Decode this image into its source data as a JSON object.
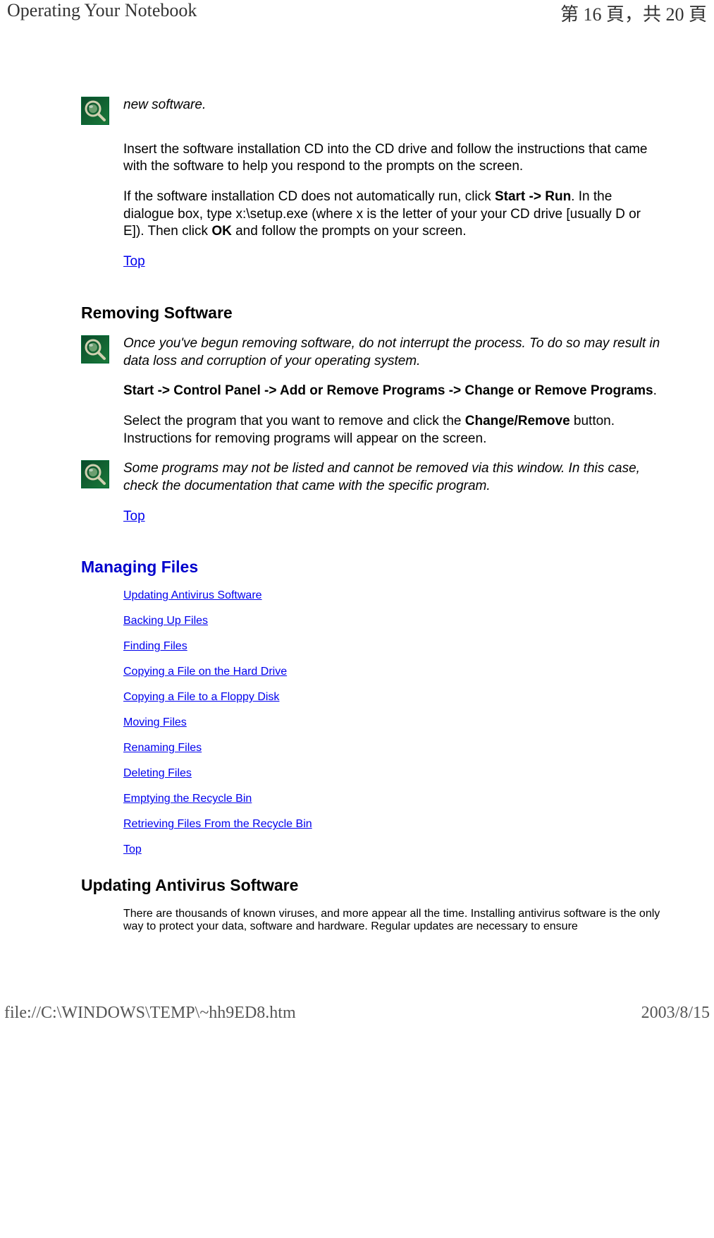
{
  "header": {
    "left": "Operating Your Notebook",
    "right": "第 16 頁，共 20 頁"
  },
  "body": {
    "note1": "new software.",
    "p1": "Insert the software installation CD into the CD drive and follow the instructions that came with the software to help you respond to the prompts on the screen.",
    "p2a": "If the software installation CD does not automatically run, click ",
    "p2b": "Start -> Run",
    "p2c": ". In the dialogue box, type x:\\setup.exe (where x is the letter of your your CD drive [usually D or E]). Then click ",
    "p2d": "OK",
    "p2e": " and follow the prompts on your screen.",
    "topLink": "Top",
    "removingHeading": "Removing Software",
    "note2": "Once you've begun removing software, do not interrupt the process. To do so may result in data loss and corruption of your operating system.",
    "p3a": "Start -> Control Panel -> Add or Remove Programs -> Change or Remove Programs",
    "p3b": ".",
    "p4a": "Select the program that you want to remove and click the ",
    "p4b": "Change/Remove",
    "p4c": " button. Instructions for removing programs will appear on the screen.",
    "note3": "Some programs may not be listed and cannot be removed via this window. In this case, check the documentation that came with the specific program.",
    "managingHeading": "Managing Files",
    "links": {
      "l1": "Updating Antivirus Software",
      "l2": "Backing Up Files",
      "l3": "Finding Files",
      "l4": "Copying a File on the Hard Drive",
      "l5": "Copying a File to a Floppy Disk",
      "l6": "Moving Files",
      "l7": "Renaming Files",
      "l8": "Deleting Files",
      "l9": "Emptying the Recycle Bin",
      "l10": "Retrieving Files From the Recycle Bin"
    },
    "updatingHeading": "Updating Antivirus Software",
    "p5": "There are thousands of known viruses, and more appear all the time. Installing antivirus software is the only way to protect your data, software and hardware. Regular updates are necessary to ensure"
  },
  "footer": {
    "left": "file://C:\\WINDOWS\\TEMP\\~hh9ED8.htm",
    "right": "2003/8/15"
  }
}
